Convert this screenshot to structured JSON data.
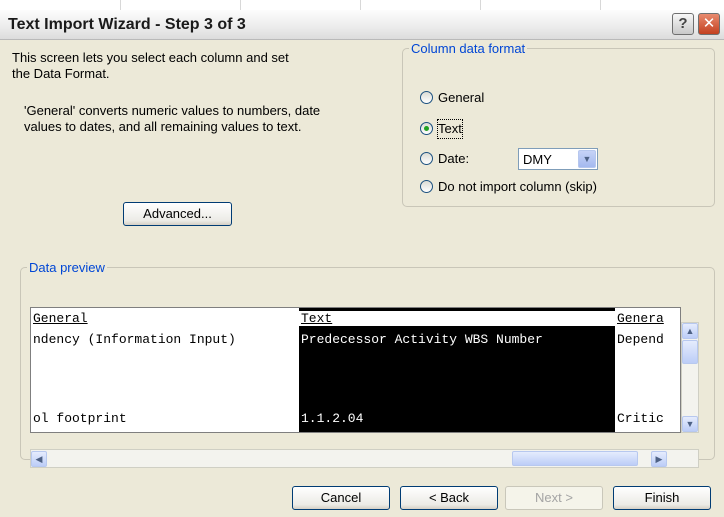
{
  "window": {
    "title": "Text Import Wizard - Step 3 of 3",
    "help": "?",
    "close": "✕"
  },
  "intro": {
    "line1": "This screen lets you select each column and set",
    "line2": "the Data Format.",
    "general_line1": "'General' converts numeric values to numbers, date",
    "general_line2": "values to dates, and all remaining values to text."
  },
  "advanced_button": "Advanced...",
  "column_format": {
    "legend": "Column data format",
    "options": [
      {
        "label": "General",
        "checked": false
      },
      {
        "label": "Text",
        "checked": true
      },
      {
        "label": "Date:",
        "checked": false
      },
      {
        "label": "Do not import column (skip)",
        "checked": false
      }
    ],
    "date_format": "DMY"
  },
  "data_preview": {
    "legend": "Data preview",
    "columns": [
      {
        "header": "General",
        "row1": "ndency (Information Input)",
        "row2": "ol footprint",
        "selected": false
      },
      {
        "header": "Text",
        "row1": "Predecessor Activity WBS Number",
        "row2": "1.1.2.04",
        "selected": true
      },
      {
        "header": "Genera",
        "row1": "Depend",
        "row2": "Critic",
        "selected": false
      }
    ]
  },
  "buttons": {
    "cancel": "Cancel",
    "back": "< Back",
    "next": "Next >",
    "finish": "Finish"
  },
  "icons": {
    "help": "question-mark-icon",
    "close": "close-icon",
    "dropdown": "chevron-down-icon"
  },
  "colors": {
    "legend": "#0046d5",
    "dialog_bg": "#ece9d8",
    "radio_selected": "#21a121"
  }
}
